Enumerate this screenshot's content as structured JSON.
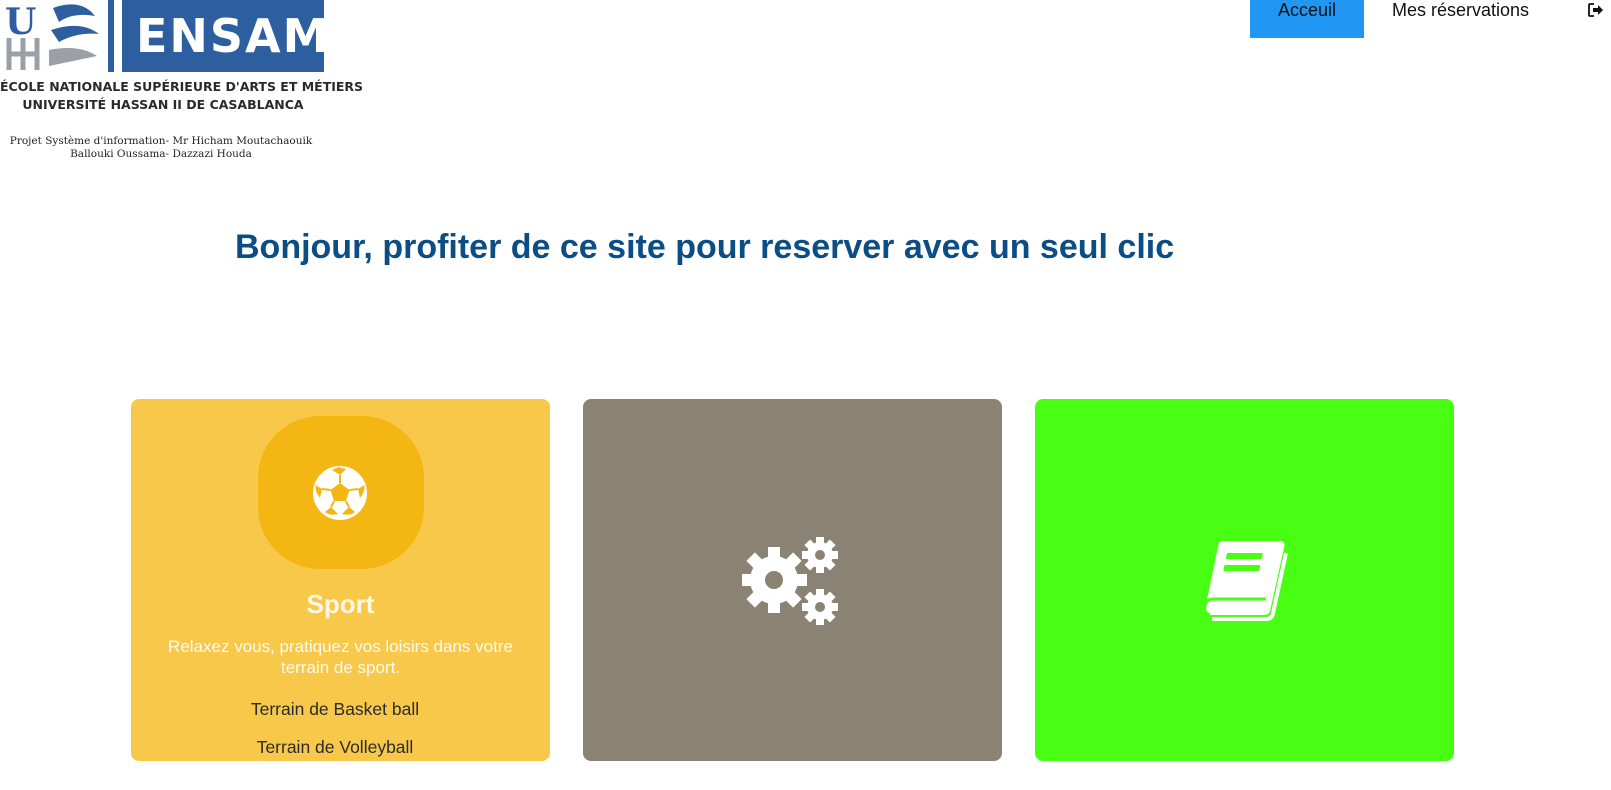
{
  "logo": {
    "monogram": "UH2",
    "name": "ENSAM",
    "school_line1": "ÉCOLE NATIONALE SUPÉRIEURE D'ARTS ET MÉTIERS",
    "school_line2": "UNIVERSITÉ HASSAN II DE CASABLANCA",
    "credit_line1": "Projet Système d'information- Mr Hicham Moutachaouik",
    "credit_line2": "Ballouki Oussama- Dazzazi Houda"
  },
  "nav": {
    "items": [
      {
        "label": "Acceuil",
        "active": true
      },
      {
        "label": "Mes réservations",
        "active": false
      }
    ],
    "logout_icon": "sign-out-icon"
  },
  "main": {
    "heading": "Bonjour, profiter de ce site pour reserver avec un seul clic"
  },
  "cards": [
    {
      "icon": "soccer-ball-icon",
      "title": "Sport",
      "description": "Relaxez vous, pratiquez vos loisirs dans votre terrain de sport.",
      "links": [
        "Terrain de Basket ball",
        "Terrain de Volleyball"
      ],
      "color": "#f7c84a",
      "icon_bg": "#f3b612"
    },
    {
      "icon": "gears-icon",
      "color": "#8a8373"
    },
    {
      "icon": "book-icon",
      "color": "#48ff14"
    }
  ],
  "colors": {
    "accent": "#2196f3",
    "heading": "#0b4d85",
    "ensam_blue": "#2d5fa0"
  }
}
